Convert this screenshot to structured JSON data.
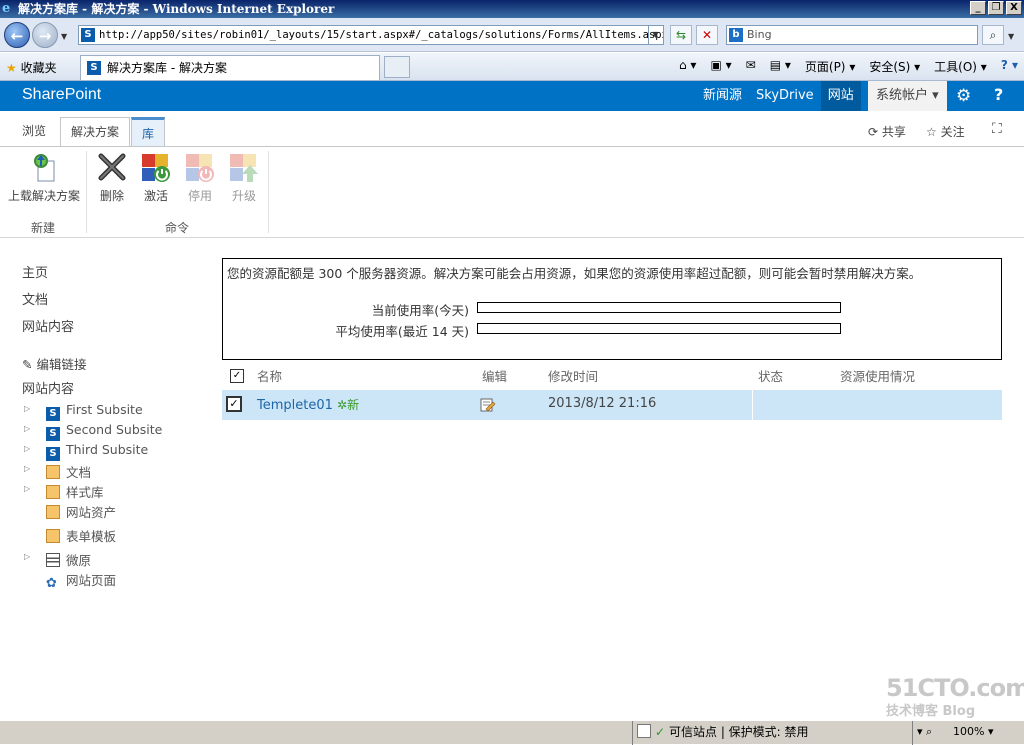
{
  "window": {
    "title": "解决方案库 - 解决方案 - Windows Internet Explorer",
    "min_glyph": "_",
    "restore_glyph": "❐",
    "close_glyph": "X"
  },
  "address_bar": {
    "url": "http://app50/sites/robin01/_layouts/15/start.aspx#/_catalogs/solutions/Forms/AllItems.aspx",
    "search_placeholder": "Bing"
  },
  "command_bar": {
    "favorites": "收藏夹",
    "tab_title": "解决方案库 - 解决方案",
    "page_menu": "页面(P)",
    "safety_menu": "安全(S)",
    "tools_menu": "工具(O)"
  },
  "suite_bar": {
    "brand": "SharePoint",
    "links": [
      "新闻源",
      "SkyDrive",
      "网站"
    ],
    "account": "系统帐户"
  },
  "ribbon_tabs": {
    "browse": "浏览",
    "solutions": "解决方案",
    "library": "库",
    "share": "共享",
    "follow": "关注"
  },
  "ribbon": {
    "upload": "上载解决方案",
    "delete": "删除",
    "activate": "激活",
    "deactivate": "停用",
    "upgrade": "升级",
    "group_new": "新建",
    "group_commands": "命令"
  },
  "left_nav": {
    "home": "主页",
    "documents": "文档",
    "site_contents": "网站内容",
    "edit_links": "编辑链接",
    "site_contents_header": "网站内容",
    "tree": [
      {
        "label": "First Subsite",
        "icon": "subsite-icon"
      },
      {
        "label": "Second Subsite",
        "icon": "subsite-icon"
      },
      {
        "label": "Third Subsite",
        "icon": "subsite-icon"
      },
      {
        "label": "文档",
        "icon": "library-icon"
      },
      {
        "label": "样式库",
        "icon": "library-icon"
      },
      {
        "label": "网站资产",
        "icon": "library-icon"
      },
      {
        "label": "表单模板",
        "icon": "library-icon"
      },
      {
        "label": "微原",
        "icon": "list-icon"
      },
      {
        "label": "网站页面",
        "icon": "pages-icon"
      }
    ]
  },
  "quota": {
    "message": "您的资源配额是 300 个服务器资源。解决方案可能会占用资源，如果您的资源使用率超过配额，则可能会暂时禁用解决方案。",
    "current_label": "当前使用率(今天)",
    "average_label": "平均使用率(最近 14 天)",
    "current_usage": 0,
    "average_usage": 0
  },
  "list": {
    "columns": [
      "名称",
      "编辑",
      "修改时间",
      "状态",
      "资源使用情况"
    ],
    "rows": [
      {
        "name": "Templete01",
        "new_badge": "新",
        "modified": "2013/8/12 21:16",
        "status": "",
        "usage": ""
      }
    ]
  },
  "status_bar": {
    "trusted": "可信站点 | 保护模式: 禁用",
    "zoom": "100%"
  },
  "watermark": {
    "site": "51CTO.com",
    "sub": "技术博客 Blog"
  }
}
